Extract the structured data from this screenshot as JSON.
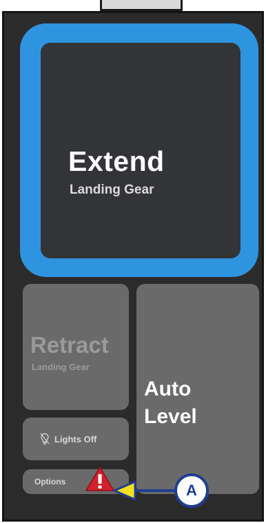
{
  "extend_button": {
    "title": "Extend",
    "subtitle": "Landing Gear"
  },
  "retract_button": {
    "title": "Retract",
    "subtitle": "Landing Gear"
  },
  "auto_level_button": {
    "line1": "Auto",
    "line2": "Level"
  },
  "lights_button": {
    "label": "Lights Off",
    "icon": "lightbulb-off-icon"
  },
  "options_button": {
    "label": "Options",
    "icon": "warning-icon"
  },
  "callout": {
    "letter": "A"
  },
  "colors": {
    "accent_blue": "#2f94e0",
    "panel_bg": "#2b2b2b",
    "button_gray": "#6a6a6a",
    "warning_red": "#d4202a",
    "callout_yellow": "#f5e020",
    "callout_navy": "#1e3f8e"
  }
}
